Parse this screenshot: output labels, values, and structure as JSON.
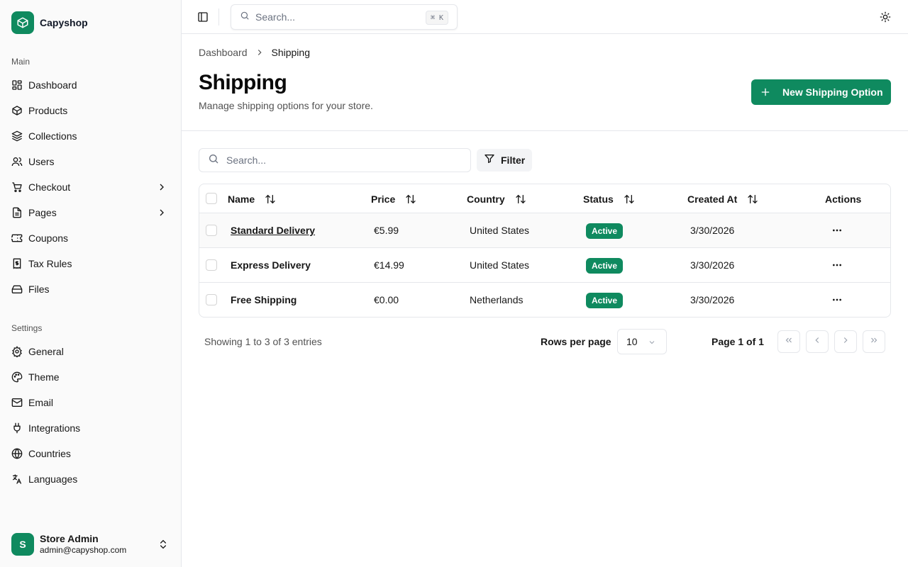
{
  "brand": {
    "name": "Capyshop",
    "logo_icon": "package-icon"
  },
  "sidebar": {
    "main_label": "Main",
    "main_items": [
      {
        "label": "Dashboard",
        "icon": "dashboard-icon"
      },
      {
        "label": "Products",
        "icon": "package-icon"
      },
      {
        "label": "Collections",
        "icon": "layers-icon"
      },
      {
        "label": "Users",
        "icon": "users-icon"
      },
      {
        "label": "Checkout",
        "icon": "cart-icon",
        "has_submenu": true
      },
      {
        "label": "Pages",
        "icon": "file-icon",
        "has_submenu": true
      },
      {
        "label": "Coupons",
        "icon": "ticket-icon"
      },
      {
        "label": "Tax Rules",
        "icon": "receipt-icon"
      },
      {
        "label": "Files",
        "icon": "hard-drive-icon"
      }
    ],
    "settings_label": "Settings",
    "settings_items": [
      {
        "label": "General",
        "icon": "gear-icon"
      },
      {
        "label": "Theme",
        "icon": "palette-icon"
      },
      {
        "label": "Email",
        "icon": "mail-icon"
      },
      {
        "label": "Integrations",
        "icon": "plug-icon"
      },
      {
        "label": "Countries",
        "icon": "globe-icon"
      },
      {
        "label": "Languages",
        "icon": "translate-icon"
      }
    ],
    "user": {
      "initial": "S",
      "name": "Store Admin",
      "email": "admin@capyshop.com"
    }
  },
  "topbar": {
    "search_placeholder": "Search...",
    "shortcut": "⌘ K"
  },
  "breadcrumb": {
    "parent": "Dashboard",
    "current": "Shipping"
  },
  "page": {
    "title": "Shipping",
    "subtitle": "Manage shipping options for your store.",
    "new_button": "New Shipping Option"
  },
  "toolbar": {
    "search_placeholder": "Search...",
    "filter_label": "Filter"
  },
  "table": {
    "columns": [
      "Name",
      "Price",
      "Country",
      "Status",
      "Created At",
      "Actions"
    ],
    "rows": [
      {
        "name": "Standard Delivery",
        "price": "€5.99",
        "country": "United States",
        "status": "Active",
        "created_at": "3/30/2026"
      },
      {
        "name": "Express Delivery",
        "price": "€14.99",
        "country": "United States",
        "status": "Active",
        "created_at": "3/30/2026"
      },
      {
        "name": "Free Shipping",
        "price": "€0.00",
        "country": "Netherlands",
        "status": "Active",
        "created_at": "3/30/2026"
      }
    ]
  },
  "pagination": {
    "entries_text": "Showing 1 to 3 of 3 entries",
    "rows_per_page_label": "Rows per page",
    "rows_per_page_value": "10",
    "page_info": "Page 1 of 1"
  },
  "colors": {
    "accent": "#0f8a5f",
    "border": "#e5e7eb",
    "muted_text": "#525252"
  }
}
